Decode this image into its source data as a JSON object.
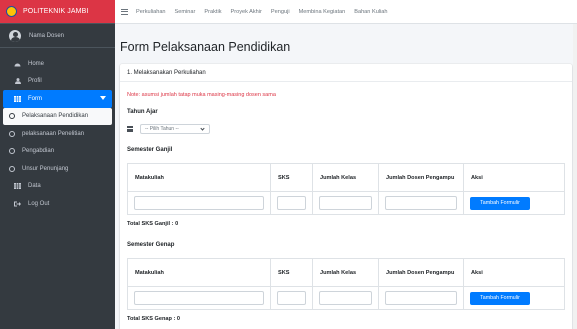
{
  "brand": {
    "name": "POLITEKNIK JAMBI"
  },
  "user": {
    "name": "Nama Dosen"
  },
  "sidebar": {
    "items": [
      {
        "label": "Home",
        "icon": "tachometer-icon"
      },
      {
        "label": "Profil",
        "icon": "user-icon"
      },
      {
        "label": "Form",
        "icon": "table-icon"
      },
      {
        "label": "Pelaksanaan Pendidikan",
        "icon": "circle-icon"
      },
      {
        "label": "pelaksanaan Penelitian",
        "icon": "circle-icon"
      },
      {
        "label": "Pengabdian",
        "icon": "circle-icon"
      },
      {
        "label": "Unsur Penunjang",
        "icon": "circle-icon"
      },
      {
        "label": "Data",
        "icon": "table-icon"
      },
      {
        "label": "Log Out",
        "icon": "sign-out-icon"
      }
    ]
  },
  "topnav": [
    "Perkuliahan",
    "Seminar",
    "Praktik",
    "Proyek Akhir",
    "Penguji",
    "Membina Kegiatan",
    "Bahan Kuliah"
  ],
  "page": {
    "title": "Form Pelaksanaan Pendidikan",
    "card_title": "1. Melaksanakan Perkuliahan",
    "note": "Note: asumsi jumlah tatap muka masing-masing dosen sama",
    "year_label": "Tahun Ajar",
    "year_select": "-- Pilih Tahun --",
    "ganjil": {
      "label": "Semester Ganjil",
      "total": "Total SKS Ganjil : 0"
    },
    "genap": {
      "label": "Semester Genap",
      "total": "Total SKS Genap : 0"
    },
    "columns": [
      "Matakuliah",
      "SKS",
      "Jumlah Kelas",
      "Jumlah Dosen Pengampu",
      "Aksi"
    ],
    "add_button": "Tambah Formulir"
  },
  "colors": {
    "brand": "#dc3545",
    "sidebar": "#343a40",
    "primary": "#007bff",
    "note": "#dc3545"
  }
}
